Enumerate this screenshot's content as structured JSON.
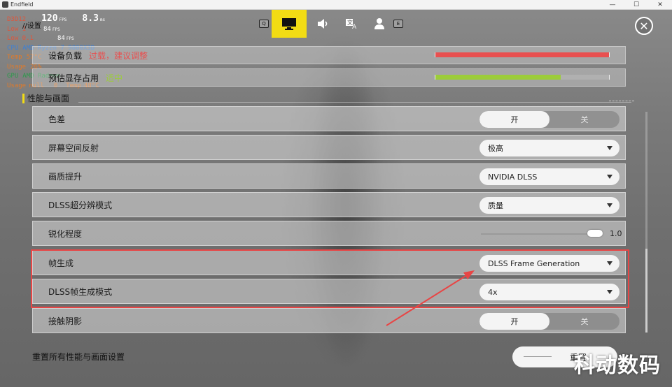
{
  "window": {
    "title": "Endfield"
  },
  "osd": {
    "fps_label": "D3D12",
    "fps": "120",
    "fps_unit": "FPS",
    "frametime": "8.3",
    "frametime_unit": "ms",
    "low1_label": "Low 1",
    "low1": "84",
    "low1_unit": "FPS",
    "low01_label": "Low 0.1",
    "low01": "84",
    "low01_unit": "FPS",
    "cpu_label": "CPU",
    "cpu_name": "AMD Ryzen 7 9800X3D",
    "temp_label": "Temp",
    "temp": "57",
    "temp_unit": "°C",
    "usage_label": "Usage",
    "usage": "26",
    "usage_unit": "%",
    "gpu_label": "GPU",
    "gpu_name": "AMD Radeon",
    "gpu_usage_label": "Usage",
    "gpu_usage": "null",
    "gpu_usage_val": "0",
    "gpu_temp_label": "Temp",
    "gpu_temp": "48",
    "gpu_temp_unit": "°C"
  },
  "page_label": "//设置",
  "topnav": {
    "key_left": "Q",
    "key_right": "E"
  },
  "status": {
    "load_name": "设备负载",
    "load_tag": "过载，建议调整",
    "load_color": "#e85050",
    "load_fill": 1.0,
    "vram_name": "预估显存占用",
    "vram_tag": "适中",
    "vram_color": "#9ccc3a",
    "vram_fill": 0.72
  },
  "section": {
    "title": "性能与画面"
  },
  "settings": [
    {
      "name": "色差",
      "type": "toggle",
      "on": "开",
      "off": "关"
    },
    {
      "name": "屏幕空间反射",
      "type": "dropdown",
      "value": "极高"
    },
    {
      "name": "画质提升",
      "type": "dropdown",
      "value": "NVIDIA DLSS"
    },
    {
      "name": "DLSS超分辨模式",
      "type": "dropdown",
      "value": "质量"
    },
    {
      "name": "锐化程度",
      "type": "slider",
      "value": "1.0",
      "level": 1.0
    },
    {
      "name": "帧生成",
      "type": "dropdown",
      "value": "DLSS Frame Generation"
    },
    {
      "name": "DLSS帧生成模式",
      "type": "dropdown",
      "value": "4x"
    },
    {
      "name": "接触阴影",
      "type": "toggle",
      "on": "开",
      "off": "关"
    }
  ],
  "footer": {
    "reset_label": "重置所有性能与画面设置",
    "reset_button": "重置",
    "watermark": "科动数码"
  }
}
